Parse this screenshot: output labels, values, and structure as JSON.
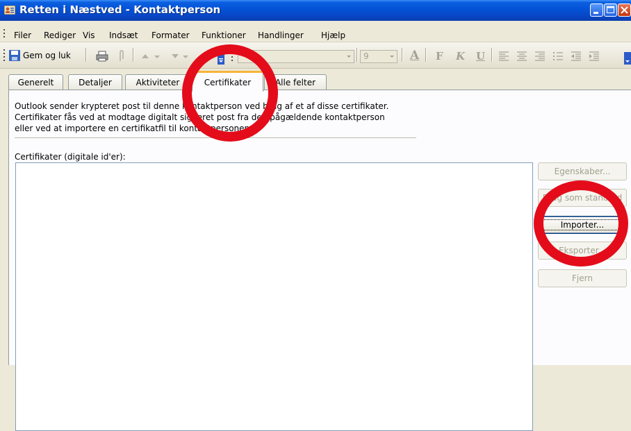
{
  "window": {
    "title": "Retten i Næstved - Kontaktperson",
    "icon": "contact-card-icon",
    "controls": [
      "minimize-icon",
      "maximize-icon",
      "close-icon"
    ]
  },
  "menu": {
    "items": [
      {
        "id": "filer",
        "label": "Filer"
      },
      {
        "id": "rediger",
        "label": "Rediger"
      },
      {
        "id": "vis",
        "label": "Vis"
      },
      {
        "id": "indsaet",
        "label": "Indsæt"
      },
      {
        "id": "formater",
        "label": "Formater"
      },
      {
        "id": "funktioner",
        "label": "Funktioner"
      },
      {
        "id": "handlinger",
        "label": "Handlinger"
      },
      {
        "id": "hjaelp",
        "label": "Hjælp"
      }
    ]
  },
  "toolbar": {
    "save_close_label": "Gem og luk",
    "font_name": "",
    "font_size": "9",
    "format_icons": [
      "font-color-icon",
      "bold-icon",
      "italic-icon",
      "underline-icon",
      "align-left-icon",
      "align-center-icon",
      "align-right-icon",
      "bullets-icon",
      "decrease-indent-icon",
      "increase-indent-icon"
    ],
    "format_labels": {
      "font_color": "A",
      "bold": "F",
      "italic": "K",
      "underline": "U"
    }
  },
  "tabs": [
    {
      "id": "generelt",
      "label": "Generelt",
      "active": false
    },
    {
      "id": "detaljer",
      "label": "Detaljer",
      "active": false
    },
    {
      "id": "aktiviteter",
      "label": "Aktiviteter",
      "active": false
    },
    {
      "id": "certifikater",
      "label": "Certifikater",
      "active": true
    },
    {
      "id": "alle-felter",
      "label": "Alle felter",
      "active": false
    }
  ],
  "certificates_page": {
    "description_lines": [
      "Outlook sender krypteret post til denne kontaktperson ved brug af et af disse certifikater.",
      "Certifikater fås ved at modtage digitalt signeret post fra den pågældende kontaktperson",
      "eller ved at importere en certifikatfil til kontaktpersonen."
    ],
    "list_label": "Certifikater (digitale id'er):",
    "buttons": [
      {
        "id": "egenskaber",
        "label": "Egenskaber...",
        "enabled": false
      },
      {
        "id": "brug-som-standard",
        "label": "Brug som standard",
        "enabled": false
      },
      {
        "id": "importer",
        "label": "Importer...",
        "enabled": true
      },
      {
        "id": "eksporter",
        "label": "Eksporter...",
        "enabled": false
      },
      {
        "id": "fjern",
        "label": "Fjern",
        "enabled": false
      }
    ]
  },
  "annotations": {
    "color": "#e40c1a",
    "targets": [
      "tab-certifikater",
      "importer-button"
    ]
  },
  "colors": {
    "titlebar": "#0452d6",
    "active_tab_highlight": "#f8b33a",
    "window_bg": "#ece9d8"
  }
}
